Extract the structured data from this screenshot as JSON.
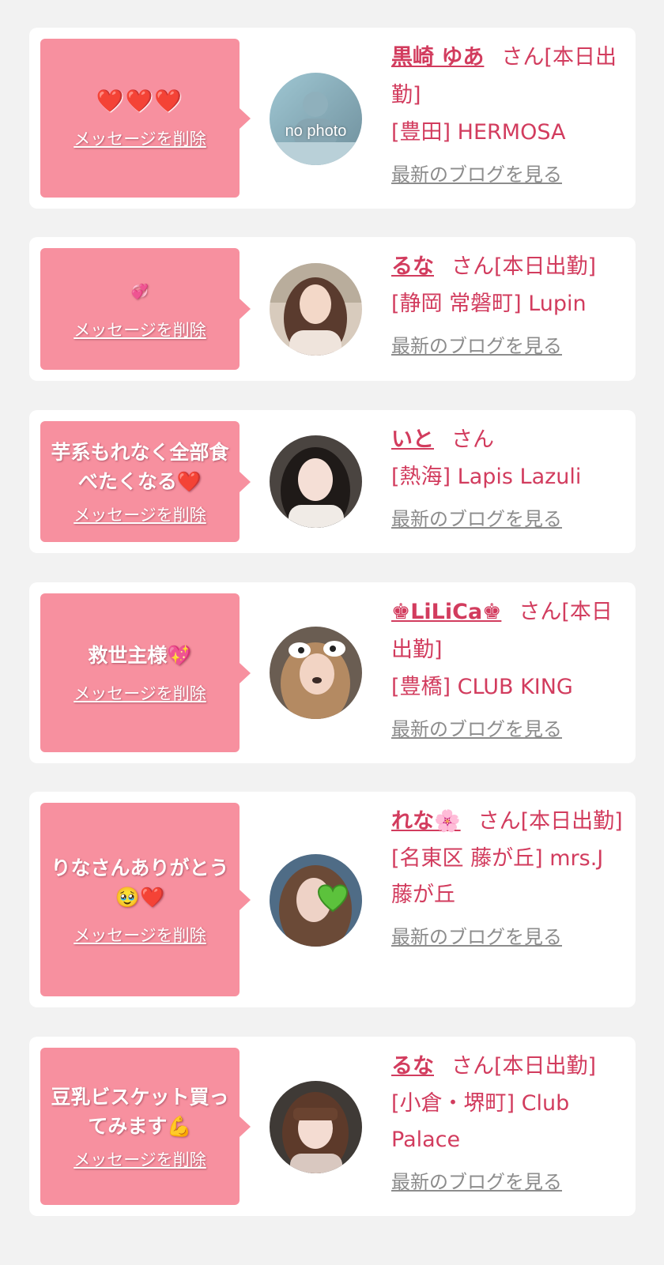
{
  "colors": {
    "background": "#f2f2f2",
    "card": "#ffffff",
    "bubble": "#f7909f",
    "accent_text": "#d23c5e",
    "link_gray": "#8c8c8c"
  },
  "delete_label": "メッセージを削除",
  "blog_label": "最新のブログを見る",
  "cards": [
    {
      "message": "❤️❤️❤️",
      "name": "黒崎 ゆあ",
      "suffix": "さん[本日出勤]",
      "shop": "[豊田] HERMOSA",
      "avatar_label": "no photo",
      "avatar_icon": "no-photo-placeholder"
    },
    {
      "message": "💞 ",
      "name": "るな",
      "suffix": "さん[本日出勤]",
      "shop": "[静岡 常磐町] Lupin",
      "avatar_icon": "profile-photo"
    },
    {
      "message": "芋系もれなく全部食べたくなる❤️",
      "name": "いと",
      "suffix": "さん",
      "shop": "[熱海] Lapis Lazuli",
      "avatar_icon": "profile-photo"
    },
    {
      "message": "救世主様💖",
      "name": "♚LiLiCa♚",
      "suffix": "さん[本日出勤]",
      "shop": "[豊橋] CLUB KING",
      "avatar_icon": "profile-photo"
    },
    {
      "message": "りなさんありがとう🥹❤️",
      "name": "れな🌸",
      "suffix": "さん[本日出勤]",
      "shop": "[名東区 藤が丘] mrs.J 藤が丘",
      "avatar_icon": "profile-photo-green-heart"
    },
    {
      "message": "豆乳ビスケット買ってみます💪",
      "name": "るな",
      "suffix": "さん[本日出勤]",
      "shop": "[小倉・堺町] Club Palace",
      "avatar_icon": "profile-photo"
    }
  ]
}
